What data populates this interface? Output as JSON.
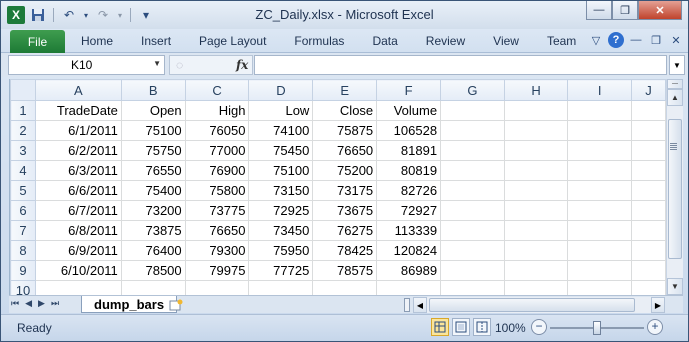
{
  "window": {
    "title": "ZC_Daily.xlsx - Microsoft Excel",
    "app_icon": "X",
    "controls": {
      "minimize": "—",
      "restore": "❐",
      "close": "✕"
    }
  },
  "qat": {
    "save": "💾",
    "undo": "↶",
    "redo": "↷",
    "customize": "▾"
  },
  "ribbon": {
    "file_label": "File",
    "tabs": [
      "Home",
      "Insert",
      "Page Layout",
      "Formulas",
      "Data",
      "Review",
      "View",
      "Team"
    ],
    "right": {
      "collapse": "▽",
      "help": "?",
      "minimize": "—",
      "restore": "❐",
      "close": "✕"
    }
  },
  "formula_bar": {
    "name_box": "K10",
    "fx_label": "fx",
    "formula_value": ""
  },
  "grid": {
    "columns": [
      "A",
      "B",
      "C",
      "D",
      "E",
      "F",
      "G",
      "H",
      "I",
      "J"
    ],
    "row_numbers": [
      "1",
      "2",
      "3",
      "4",
      "5",
      "6",
      "7",
      "8",
      "9",
      "10"
    ],
    "headers": [
      "TradeDate",
      "Open",
      "High",
      "Low",
      "Close",
      "Volume"
    ],
    "rows": [
      [
        "6/1/2011",
        "75100",
        "76050",
        "74100",
        "75875",
        "106528"
      ],
      [
        "6/2/2011",
        "75750",
        "77000",
        "75450",
        "76650",
        "81891"
      ],
      [
        "6/3/2011",
        "76550",
        "76900",
        "75100",
        "75200",
        "80819"
      ],
      [
        "6/6/2011",
        "75400",
        "75800",
        "73150",
        "73175",
        "82726"
      ],
      [
        "6/7/2011",
        "73200",
        "73775",
        "72925",
        "73675",
        "72927"
      ],
      [
        "6/8/2011",
        "73875",
        "76650",
        "73450",
        "76275",
        "113339"
      ],
      [
        "6/9/2011",
        "76400",
        "79300",
        "75950",
        "78425",
        "120824"
      ],
      [
        "6/10/2011",
        "78500",
        "79975",
        "77725",
        "78575",
        "86989"
      ]
    ]
  },
  "sheets": {
    "active": "dump_bars",
    "nav": [
      "⏮",
      "◀",
      "▶",
      "⏭"
    ]
  },
  "status": {
    "text": "Ready",
    "zoom": "100%",
    "zoom_fraction": 0.5,
    "zoom_minus": "−",
    "zoom_plus": "+"
  }
}
